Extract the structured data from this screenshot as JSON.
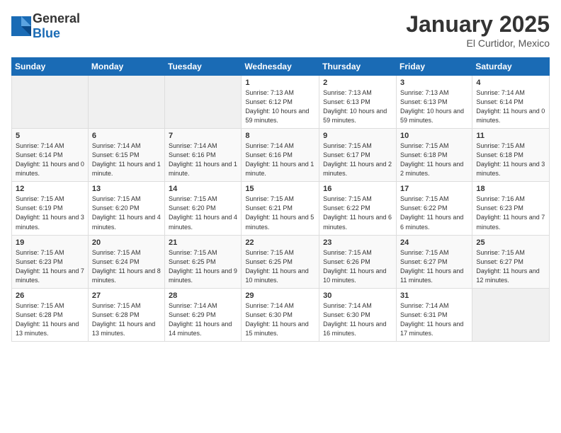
{
  "header": {
    "logo_general": "General",
    "logo_blue": "Blue",
    "month": "January 2025",
    "location": "El Curtidor, Mexico"
  },
  "days_of_week": [
    "Sunday",
    "Monday",
    "Tuesday",
    "Wednesday",
    "Thursday",
    "Friday",
    "Saturday"
  ],
  "weeks": [
    [
      {
        "day": "",
        "info": ""
      },
      {
        "day": "",
        "info": ""
      },
      {
        "day": "",
        "info": ""
      },
      {
        "day": "1",
        "info": "Sunrise: 7:13 AM\nSunset: 6:12 PM\nDaylight: 10 hours and 59 minutes."
      },
      {
        "day": "2",
        "info": "Sunrise: 7:13 AM\nSunset: 6:13 PM\nDaylight: 10 hours and 59 minutes."
      },
      {
        "day": "3",
        "info": "Sunrise: 7:13 AM\nSunset: 6:13 PM\nDaylight: 10 hours and 59 minutes."
      },
      {
        "day": "4",
        "info": "Sunrise: 7:14 AM\nSunset: 6:14 PM\nDaylight: 11 hours and 0 minutes."
      }
    ],
    [
      {
        "day": "5",
        "info": "Sunrise: 7:14 AM\nSunset: 6:14 PM\nDaylight: 11 hours and 0 minutes."
      },
      {
        "day": "6",
        "info": "Sunrise: 7:14 AM\nSunset: 6:15 PM\nDaylight: 11 hours and 1 minute."
      },
      {
        "day": "7",
        "info": "Sunrise: 7:14 AM\nSunset: 6:16 PM\nDaylight: 11 hours and 1 minute."
      },
      {
        "day": "8",
        "info": "Sunrise: 7:14 AM\nSunset: 6:16 PM\nDaylight: 11 hours and 1 minute."
      },
      {
        "day": "9",
        "info": "Sunrise: 7:15 AM\nSunset: 6:17 PM\nDaylight: 11 hours and 2 minutes."
      },
      {
        "day": "10",
        "info": "Sunrise: 7:15 AM\nSunset: 6:18 PM\nDaylight: 11 hours and 2 minutes."
      },
      {
        "day": "11",
        "info": "Sunrise: 7:15 AM\nSunset: 6:18 PM\nDaylight: 11 hours and 3 minutes."
      }
    ],
    [
      {
        "day": "12",
        "info": "Sunrise: 7:15 AM\nSunset: 6:19 PM\nDaylight: 11 hours and 3 minutes."
      },
      {
        "day": "13",
        "info": "Sunrise: 7:15 AM\nSunset: 6:20 PM\nDaylight: 11 hours and 4 minutes."
      },
      {
        "day": "14",
        "info": "Sunrise: 7:15 AM\nSunset: 6:20 PM\nDaylight: 11 hours and 4 minutes."
      },
      {
        "day": "15",
        "info": "Sunrise: 7:15 AM\nSunset: 6:21 PM\nDaylight: 11 hours and 5 minutes."
      },
      {
        "day": "16",
        "info": "Sunrise: 7:15 AM\nSunset: 6:22 PM\nDaylight: 11 hours and 6 minutes."
      },
      {
        "day": "17",
        "info": "Sunrise: 7:15 AM\nSunset: 6:22 PM\nDaylight: 11 hours and 6 minutes."
      },
      {
        "day": "18",
        "info": "Sunrise: 7:16 AM\nSunset: 6:23 PM\nDaylight: 11 hours and 7 minutes."
      }
    ],
    [
      {
        "day": "19",
        "info": "Sunrise: 7:15 AM\nSunset: 6:23 PM\nDaylight: 11 hours and 7 minutes."
      },
      {
        "day": "20",
        "info": "Sunrise: 7:15 AM\nSunset: 6:24 PM\nDaylight: 11 hours and 8 minutes."
      },
      {
        "day": "21",
        "info": "Sunrise: 7:15 AM\nSunset: 6:25 PM\nDaylight: 11 hours and 9 minutes."
      },
      {
        "day": "22",
        "info": "Sunrise: 7:15 AM\nSunset: 6:25 PM\nDaylight: 11 hours and 10 minutes."
      },
      {
        "day": "23",
        "info": "Sunrise: 7:15 AM\nSunset: 6:26 PM\nDaylight: 11 hours and 10 minutes."
      },
      {
        "day": "24",
        "info": "Sunrise: 7:15 AM\nSunset: 6:27 PM\nDaylight: 11 hours and 11 minutes."
      },
      {
        "day": "25",
        "info": "Sunrise: 7:15 AM\nSunset: 6:27 PM\nDaylight: 11 hours and 12 minutes."
      }
    ],
    [
      {
        "day": "26",
        "info": "Sunrise: 7:15 AM\nSunset: 6:28 PM\nDaylight: 11 hours and 13 minutes."
      },
      {
        "day": "27",
        "info": "Sunrise: 7:15 AM\nSunset: 6:28 PM\nDaylight: 11 hours and 13 minutes."
      },
      {
        "day": "28",
        "info": "Sunrise: 7:14 AM\nSunset: 6:29 PM\nDaylight: 11 hours and 14 minutes."
      },
      {
        "day": "29",
        "info": "Sunrise: 7:14 AM\nSunset: 6:30 PM\nDaylight: 11 hours and 15 minutes."
      },
      {
        "day": "30",
        "info": "Sunrise: 7:14 AM\nSunset: 6:30 PM\nDaylight: 11 hours and 16 minutes."
      },
      {
        "day": "31",
        "info": "Sunrise: 7:14 AM\nSunset: 6:31 PM\nDaylight: 11 hours and 17 minutes."
      },
      {
        "day": "",
        "info": ""
      }
    ]
  ]
}
